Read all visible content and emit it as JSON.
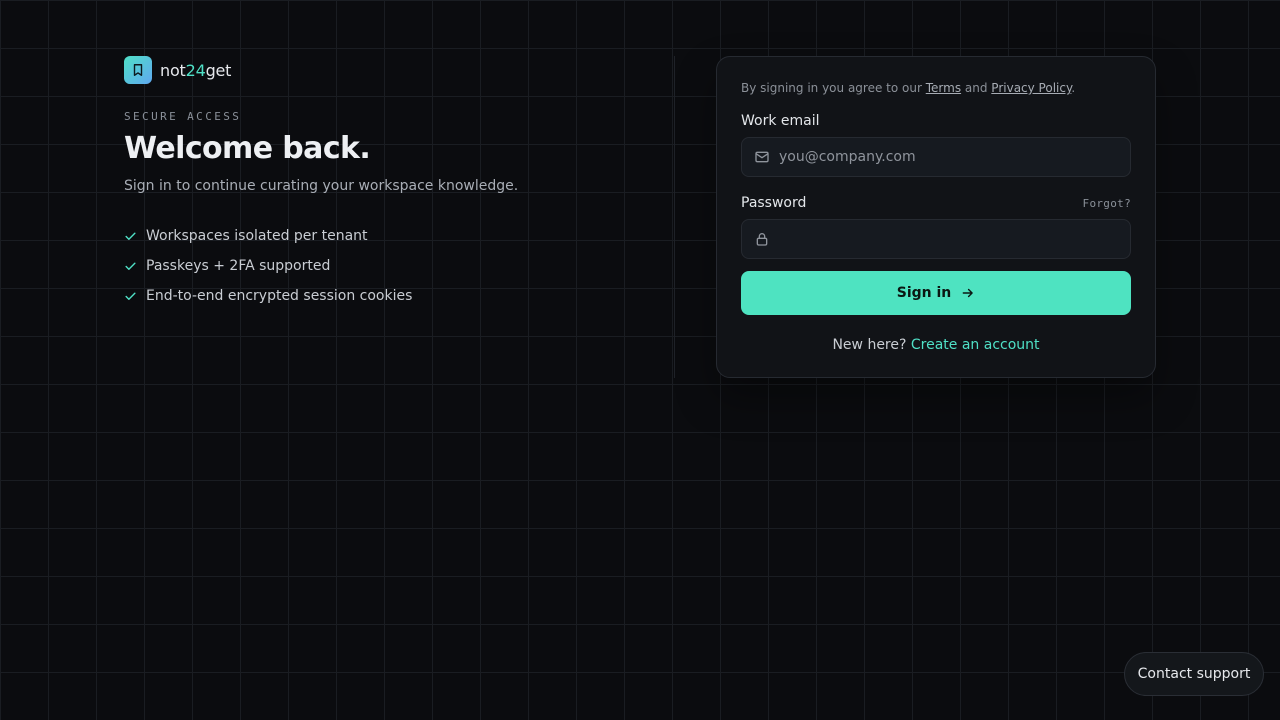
{
  "brand": {
    "name_prefix": "not",
    "name_accent": "24",
    "name_suffix": "get",
    "accent_color": "#4fe0c6"
  },
  "hero": {
    "eyebrow": "SECURE ACCESS",
    "title": "Welcome back.",
    "subtitle": "Sign in to continue curating your workspace knowledge.",
    "features": [
      "Workspaces isolated per tenant",
      "Passkeys + 2FA supported",
      "End-to-end encrypted session cookies"
    ]
  },
  "form": {
    "terms_prefix": "By signing in you agree to our ",
    "terms_link": "Terms",
    "terms_and": " and ",
    "privacy_link": "Privacy Policy",
    "terms_suffix": ".",
    "email_label": "Work email",
    "email_placeholder": "you@company.com",
    "password_label": "Password",
    "forgot_label": "Forgot?",
    "submit_label": "Sign in",
    "signup_prompt": "New here? ",
    "signup_link": "Create an account"
  },
  "support": {
    "label": "Contact support"
  },
  "icons": {
    "logo": "bookmark-icon",
    "feature": "check-icon",
    "email": "mail-icon",
    "password": "lock-icon",
    "submit": "arrow-right-icon"
  }
}
